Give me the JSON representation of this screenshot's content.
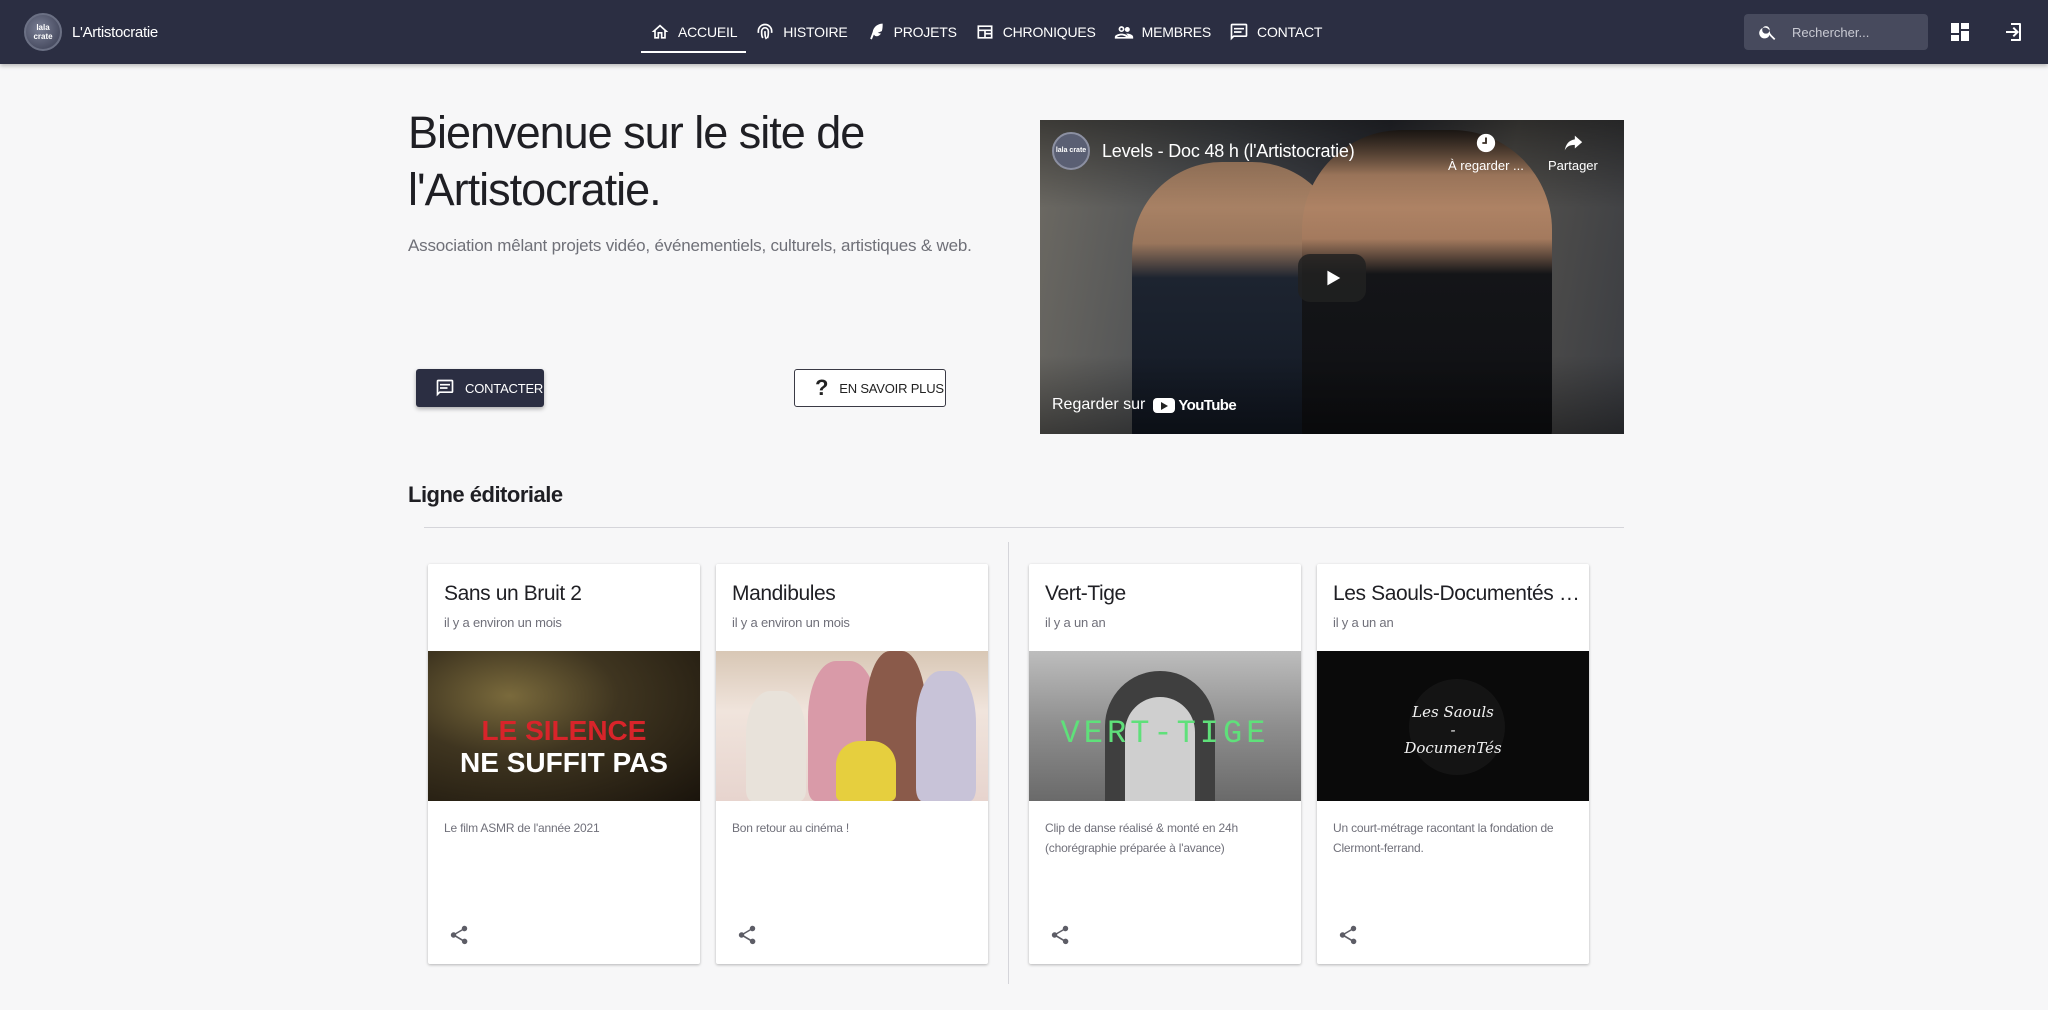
{
  "brand": {
    "name": "L'Artistocratie",
    "logo_text": "lala crate"
  },
  "nav": [
    {
      "label": "Accueil",
      "icon": "home-icon",
      "active": true
    },
    {
      "label": "Histoire",
      "icon": "fingerprint-icon"
    },
    {
      "label": "Projets",
      "icon": "feather-icon"
    },
    {
      "label": "Chroniques",
      "icon": "newspaper-icon"
    },
    {
      "label": "Membres",
      "icon": "people-icon"
    },
    {
      "label": "Contact",
      "icon": "message-icon"
    }
  ],
  "search": {
    "placeholder": "Rechercher..."
  },
  "hero": {
    "title": "Bienvenue sur le site de l'Artistocratie.",
    "subtitle": "Association mêlant projets vidéo, événementiels, culturels, artistiques & web.",
    "contact_label": "Contacter",
    "more_label": "En savoir plus",
    "more_icon": "?"
  },
  "video": {
    "title": "Levels - Doc 48 h (l'Artistocratie)",
    "logo_text": "lala crate",
    "watch_later": "À regarder ...",
    "share": "Partager",
    "watch_on": "Regarder sur",
    "youtube": "YouTube"
  },
  "editorial": {
    "title": "Ligne éditoriale",
    "cards": [
      {
        "title": "Sans un Bruit 2",
        "date": "il y a environ un mois",
        "description": "Le film ASMR de l'année 2021",
        "img_line1": "LE SILENCE",
        "img_line2": "NE SUFFIT PAS"
      },
      {
        "title": "Mandibules",
        "date": "il y a environ un mois",
        "description": "Bon retour au cinéma !"
      },
      {
        "title": "Vert-Tige",
        "date": "il y a un an",
        "description": "Clip de danse réalisé & monté en 24h (chorégraphie préparée à l'avance)",
        "img_text": "VERT-TIGE"
      },
      {
        "title": "Les Saouls-Documentés (c...",
        "date": "il y a un an",
        "description": "Un court-métrage racontant la fondation de Clermont-ferrand.",
        "img_line1": "Les Saouls",
        "img_line2": "-",
        "img_line3": "DocumenTés"
      }
    ]
  },
  "colors": {
    "topbar": "#2b2e42",
    "background": "#f7f7f8",
    "accent_red": "#d8242a",
    "accent_green": "#5fe07a"
  }
}
